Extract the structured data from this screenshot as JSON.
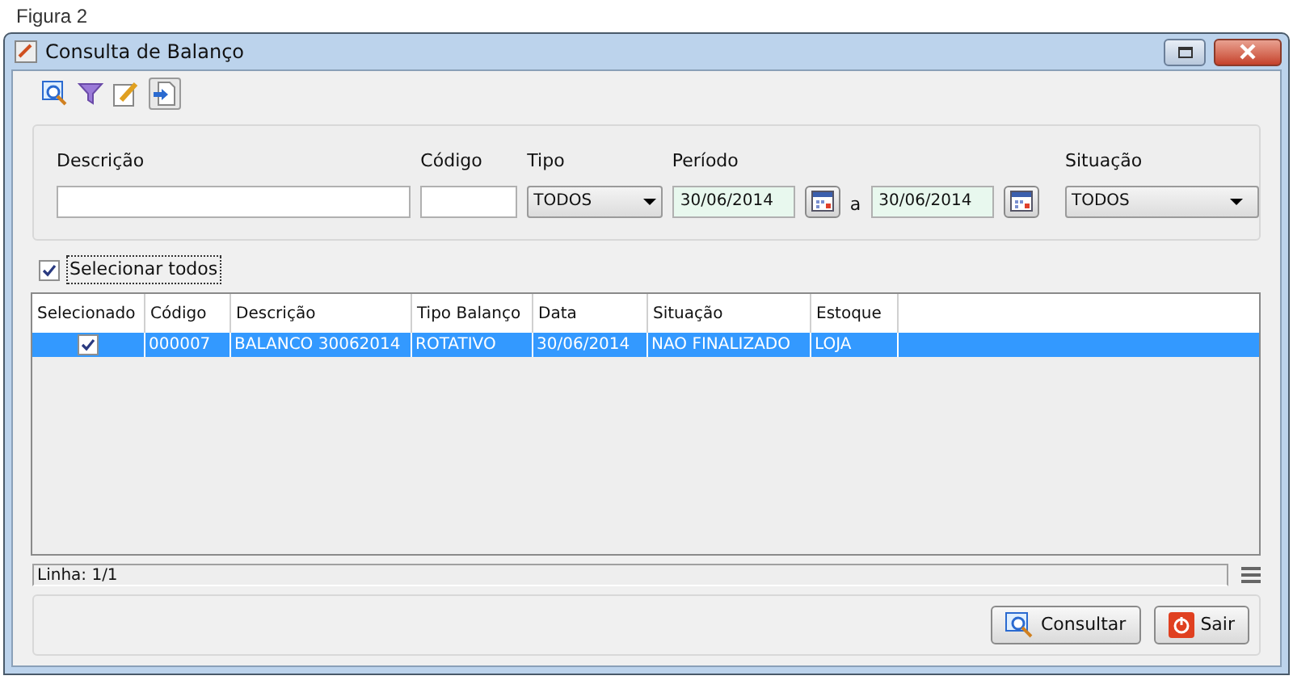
{
  "caption": "Figura 2",
  "window": {
    "title": "Consulta de Balanço"
  },
  "filters": {
    "descricao": {
      "label": "Descrição"
    },
    "codigo": {
      "label": "Código"
    },
    "tipo": {
      "label": "Tipo",
      "value": "TODOS"
    },
    "periodo": {
      "label": "Período",
      "from": "30/06/2014",
      "separator": "a",
      "to": "30/06/2014"
    },
    "situacao": {
      "label": "Situação",
      "value": "TODOS"
    }
  },
  "select_all": {
    "label": "Selecionar todos",
    "checked": true
  },
  "table": {
    "columns": [
      "Selecionado",
      "Código",
      "Descrição",
      "Tipo Balanço",
      "Data",
      "Situação",
      "Estoque"
    ],
    "rows": [
      {
        "selected": true,
        "checked": true,
        "cells": [
          "",
          "000007",
          "BALANCO 30062014",
          "ROTATIVO",
          "30/06/2014",
          "NAO FINALIZADO",
          "LOJA"
        ]
      }
    ]
  },
  "status_bar": {
    "text": "Linha: 1/1"
  },
  "buttons": [
    {
      "kind": "search",
      "label": "Consultar"
    },
    {
      "kind": "exit",
      "label": "Sair"
    }
  ]
}
